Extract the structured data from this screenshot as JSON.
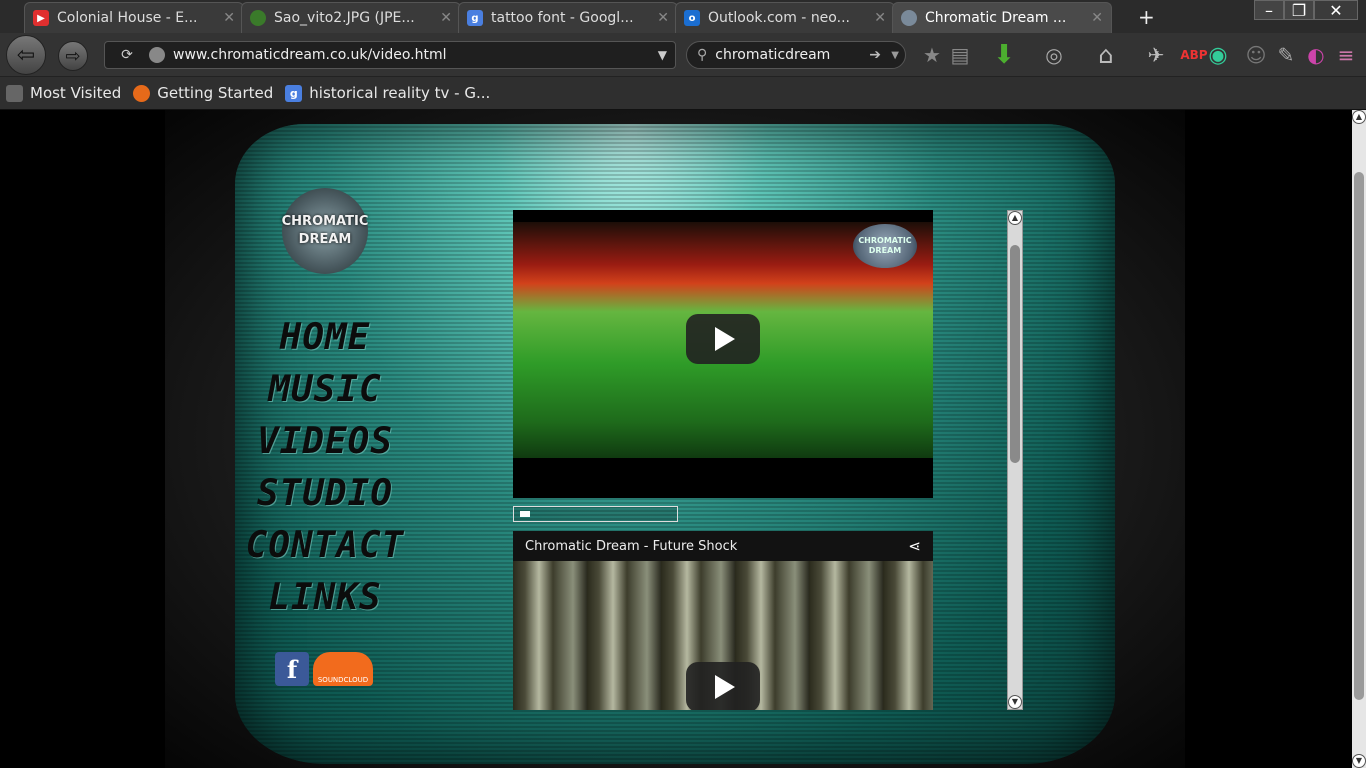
{
  "browser": {
    "tabs": [
      {
        "label": "Colonial House - E...",
        "icon": "youtube-icon",
        "color": "#e02f2f"
      },
      {
        "label": "Sao_vito2.JPG (JPE...",
        "icon": "wikimedia-icon",
        "color": "#3a7a2a"
      },
      {
        "label": "tattoo font - Googl...",
        "icon": "google-icon",
        "color": "#4a7fe0"
      },
      {
        "label": "Outlook.com - neo...",
        "icon": "outlook-icon",
        "color": "#1b6ed1"
      },
      {
        "label": "Chromatic Dream ...",
        "icon": "chromatic-dream-icon",
        "color": "#7a8a9a"
      }
    ],
    "url": "www.chromaticdream.co.uk/video.html",
    "search_query": "chromaticdream",
    "bookmarks": [
      {
        "label": "Most Visited"
      },
      {
        "label": "Getting Started"
      },
      {
        "label": "historical reality tv - G..."
      }
    ]
  },
  "site": {
    "logo_line1": "CHROMATIC",
    "logo_line2": "DREAM",
    "nav": [
      "HOME",
      "MUSIC",
      "VIDEOS",
      "STUDIO",
      "CONTACT",
      "LINKS"
    ],
    "facebook_letter": "f",
    "soundcloud_label": "SOUNDCLOUD",
    "video1_logo": "CHROMATIC DREAM",
    "video2_title": "Chromatic Dream - Future Shock"
  },
  "colors": {
    "screen_teal": "#2a8b80",
    "facebook_blue": "#3b5998",
    "soundcloud_orange": "#f26b1d"
  }
}
